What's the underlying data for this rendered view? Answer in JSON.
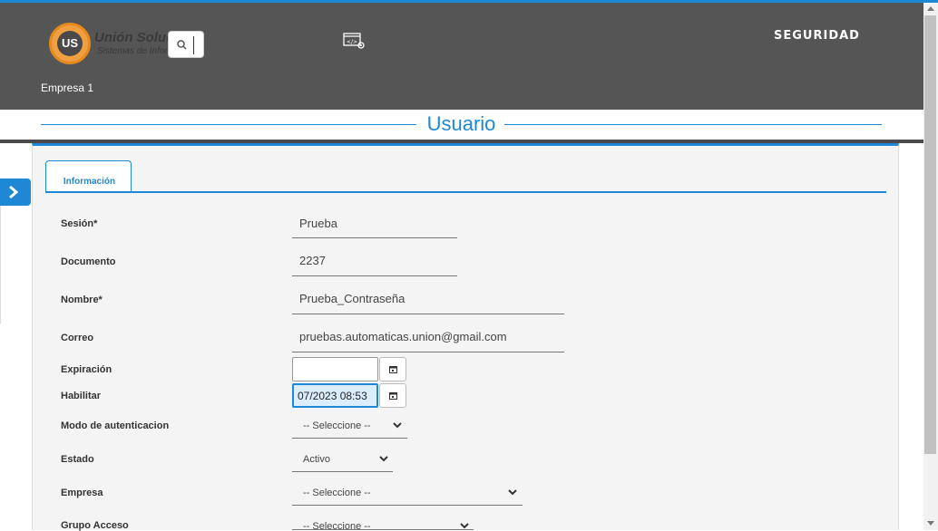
{
  "header": {
    "logo_text": "US",
    "brand_name": "Unión Soluciones",
    "brand_sub": "Sistemas de Información",
    "module": "SEGURIDAD",
    "company": "Empresa 1"
  },
  "page": {
    "title": "Usuario"
  },
  "tabs": [
    {
      "label": "Información",
      "active": true
    }
  ],
  "form": {
    "session": {
      "label": "Sesión*",
      "value": "Prueba"
    },
    "document": {
      "label": "Documento",
      "value": "2237"
    },
    "name": {
      "label": "Nombre*",
      "value": "Prueba_Contraseña"
    },
    "email": {
      "label": "Correo",
      "value": "pruebas.automaticas.union@gmail.com"
    },
    "expiration": {
      "label": "Expiración",
      "value": ""
    },
    "enable": {
      "label": "Habilitar",
      "value": "07/2023 08:53"
    },
    "auth_mode": {
      "label": "Modo de autenticacion",
      "selected": "-- Seleccione --"
    },
    "status": {
      "label": "Estado",
      "selected": "Activo"
    },
    "company": {
      "label": "Empresa",
      "selected": "-- Seleccione --"
    },
    "access_group": {
      "label": "Grupo Acceso",
      "selected": "-- Seleccione --"
    }
  },
  "colors": {
    "accent": "#1e88d6",
    "header_bg": "#555555",
    "logo": "#f0a040"
  },
  "icons": [
    "search-icon",
    "developer-settings-icon",
    "chevron-right-icon",
    "calendar-icon",
    "chevron-down-icon"
  ]
}
